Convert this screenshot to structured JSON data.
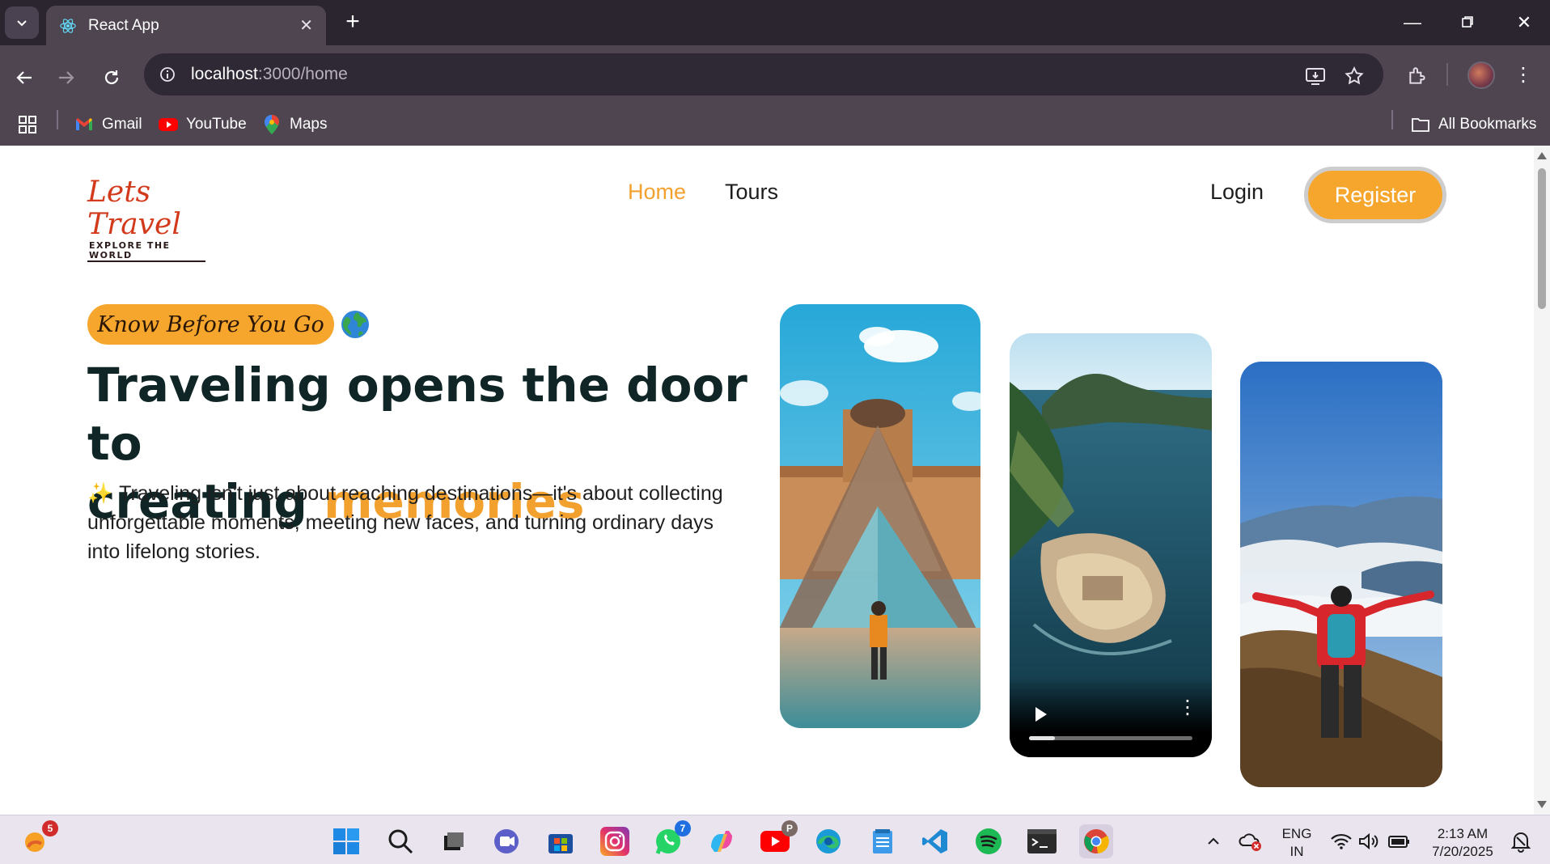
{
  "browser": {
    "tab_title": "React App",
    "url_host": "localhost",
    "url_path": ":3000/home",
    "bookmarks": [
      {
        "label": "Gmail"
      },
      {
        "label": "YouTube"
      },
      {
        "label": "Maps"
      }
    ],
    "all_bookmarks": "All Bookmarks"
  },
  "site": {
    "logo_main": "Lets Travel",
    "logo_tagline": "EXPLORE THE WORLD",
    "nav": {
      "home": "Home",
      "tours": "Tours",
      "login": "Login",
      "register": "Register"
    },
    "hero": {
      "pill": "Know Before You Go",
      "headline_1": "Traveling opens the door to",
      "headline_2": "creating",
      "headline_accent": "memories",
      "sparkle": "✨",
      "subtext": "Traveling isn't just about reaching destinations—it's about collecting unforgettable moments, meeting new faces, and turning ordinary days into lifelong stories."
    },
    "video": {
      "progress_percent": 16
    }
  },
  "taskbar": {
    "weather_badge": "5",
    "whatsapp_badge": "7",
    "youtube_badge": "P",
    "lang_1": "ENG",
    "lang_2": "IN",
    "time": "2:13 AM",
    "date": "7/20/2025"
  },
  "colors": {
    "accent": "#f6a62d",
    "headline": "#0f2526",
    "logo": "#d33a1c"
  }
}
